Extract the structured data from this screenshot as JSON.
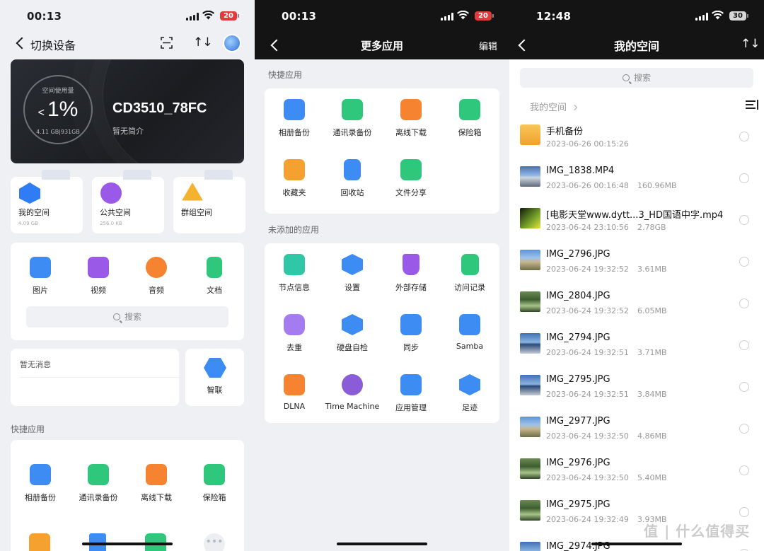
{
  "panel1": {
    "time": "00:13",
    "battery": "20",
    "header": {
      "back_label": "切换设备"
    },
    "storage": {
      "label": "空间使用量",
      "prefix": "<",
      "percent": "1%",
      "capacity": "4.11 GB|931GB",
      "used_fraction": 0.0044,
      "device_name": "CD3510_78FC",
      "description": "暂无简介"
    },
    "spaces": [
      {
        "name": "我的空间",
        "size": "4.09 GB",
        "color": "#2f7cf6"
      },
      {
        "name": "公共空间",
        "size": "256.0 KB",
        "color": "#9b59e8"
      },
      {
        "name": "群组空间",
        "size": "",
        "color": "#f5b22f"
      }
    ],
    "media": [
      {
        "label": "图片",
        "icon": "image-icon",
        "color": "#3c8cf3"
      },
      {
        "label": "视频",
        "icon": "video-icon",
        "color": "#9b59e8"
      },
      {
        "label": "音频",
        "icon": "music-icon",
        "color": "#f5832f"
      },
      {
        "label": "文档",
        "icon": "document-icon",
        "color": "#2fc77c"
      }
    ],
    "search_placeholder": "搜索",
    "messages": {
      "empty": "暂无消息"
    },
    "zhilian": {
      "label": "智联"
    },
    "quick_title": "快捷应用",
    "quick_apps": [
      {
        "label": "相册备份",
        "icon": "photo-backup-icon",
        "color": "#3c8cf3"
      },
      {
        "label": "通讯录备份",
        "icon": "contacts-backup-icon",
        "color": "#2fc77c"
      },
      {
        "label": "离线下载",
        "icon": "offline-download-icon",
        "color": "#f5832f"
      },
      {
        "label": "保险箱",
        "icon": "safe-icon",
        "color": "#2fc77c"
      }
    ]
  },
  "panel2": {
    "time": "00:13",
    "battery": "20",
    "title": "更多应用",
    "edit_label": "编辑",
    "quick_title": "快捷应用",
    "quick_apps": [
      {
        "label": "相册备份",
        "icon": "photo-backup-icon",
        "color": "#3c8cf3"
      },
      {
        "label": "通讯录备份",
        "icon": "contacts-backup-icon",
        "color": "#2fc77c"
      },
      {
        "label": "离线下载",
        "icon": "offline-download-icon",
        "color": "#f5832f"
      },
      {
        "label": "保险箱",
        "icon": "safe-icon",
        "color": "#2fc77c"
      },
      {
        "label": "收藏夹",
        "icon": "favorites-icon",
        "color": "#f5a12f"
      },
      {
        "label": "回收站",
        "icon": "trash-icon",
        "color": "#3c8cf3"
      },
      {
        "label": "文件分享",
        "icon": "share-icon",
        "color": "#2fc77c"
      }
    ],
    "unadded_title": "未添加的应用",
    "unadded_apps": [
      {
        "label": "节点信息",
        "icon": "node-info-icon",
        "color": "#2fc7a5"
      },
      {
        "label": "设置",
        "icon": "settings-icon",
        "color": "#3c8cf3"
      },
      {
        "label": "外部存储",
        "icon": "usb-storage-icon",
        "color": "#9b59e8"
      },
      {
        "label": "访问记录",
        "icon": "access-log-icon",
        "color": "#2fc77c"
      },
      {
        "label": "去重",
        "icon": "dedupe-icon",
        "color": "#a57bf0"
      },
      {
        "label": "硬盘自检",
        "icon": "disk-check-icon",
        "color": "#3c8cf3"
      },
      {
        "label": "同步",
        "icon": "sync-icon",
        "color": "#3c8cf3"
      },
      {
        "label": "Samba",
        "icon": "samba-icon",
        "color": "#3c8cf3"
      },
      {
        "label": "DLNA",
        "icon": "dlna-icon",
        "color": "#f5832f"
      },
      {
        "label": "Time Machine",
        "icon": "time-machine-icon",
        "color": "#8a5cd8"
      },
      {
        "label": "应用管理",
        "icon": "app-manage-icon",
        "color": "#3c8cf3"
      },
      {
        "label": "足迹",
        "icon": "footprint-icon",
        "color": "#3c8cf3"
      }
    ]
  },
  "panel3": {
    "time": "12:48",
    "battery": "30",
    "title": "我的空间",
    "search_placeholder": "搜索",
    "breadcrumb": "我的空间",
    "files": [
      {
        "name": "手机备份",
        "date": "2023-06-26 00:15:26",
        "size": "",
        "thumb": "folder"
      },
      {
        "name": "IMG_1838.MP4",
        "date": "2023-06-26 00:16:48",
        "size": "160.96MB",
        "thumb": "video"
      },
      {
        "name": "[电影天堂www.dytt...3_HD国语中字.mp4",
        "date": "2023-06-24 23:10:56",
        "size": "2.78GB",
        "thumb": "movie"
      },
      {
        "name": "IMG_2796.JPG",
        "date": "2023-06-24 19:32:52",
        "size": "3.61MB",
        "thumb": "beach"
      },
      {
        "name": "IMG_2804.JPG",
        "date": "2023-06-24 19:32:52",
        "size": "6.05MB",
        "thumb": "forest"
      },
      {
        "name": "IMG_2794.JPG",
        "date": "2023-06-24 19:32:51",
        "size": "3.71MB",
        "thumb": "sea"
      },
      {
        "name": "IMG_2795.JPG",
        "date": "2023-06-24 19:32:51",
        "size": "3.84MB",
        "thumb": "sea"
      },
      {
        "name": "IMG_2977.JPG",
        "date": "2023-06-24 19:32:50",
        "size": "4.86MB",
        "thumb": "beach"
      },
      {
        "name": "IMG_2976.JPG",
        "date": "2023-06-24 19:32:50",
        "size": "5.40MB",
        "thumb": "forest"
      },
      {
        "name": "IMG_2975.JPG",
        "date": "2023-06-24 19:32:49",
        "size": "3.93MB",
        "thumb": "forest"
      },
      {
        "name": "IMG_2974.JPG",
        "date": "",
        "size": "",
        "thumb": "sea"
      }
    ]
  },
  "watermark": "值 | 什么值得买"
}
